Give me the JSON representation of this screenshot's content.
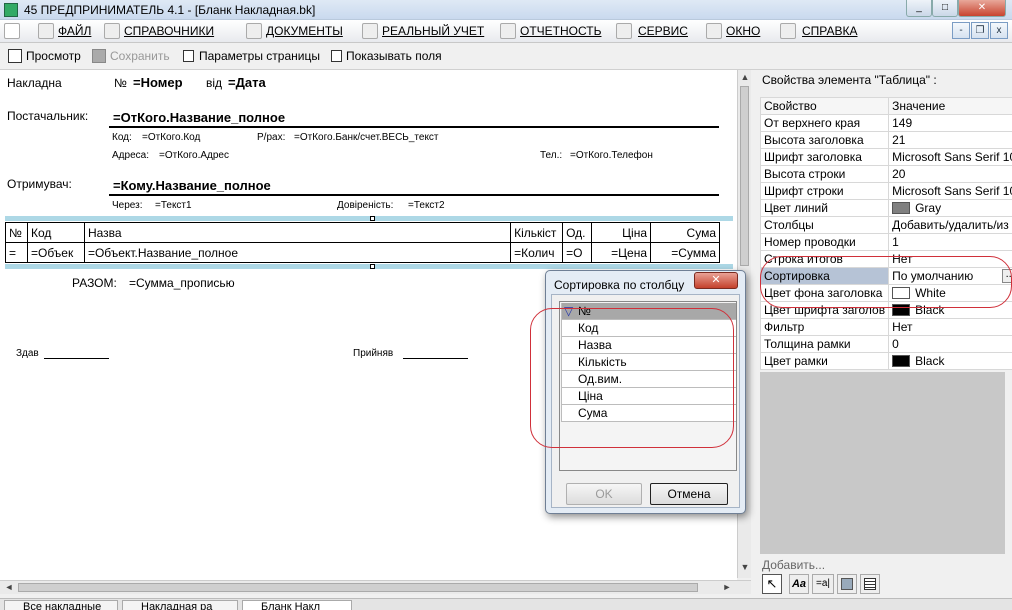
{
  "window": {
    "title": "45  ПРЕДПРИНИМАТЕЛЬ 4.1 - [Бланк  Накладная.bk]",
    "minimize": "_",
    "maximize": "□",
    "close": "✕"
  },
  "menu": {
    "items": [
      "ФАЙЛ",
      "СПРАВОЧНИКИ",
      "ДОКУМЕНТЫ",
      "РЕАЛЬНЫЙ УЧЕТ",
      "ОТЧЕТНОСТЬ",
      "СЕРВИС",
      "ОКНО",
      "СПРАВКА"
    ],
    "mdi_minimize": "-",
    "mdi_restore": "❐",
    "mdi_close": "x"
  },
  "toolbar": {
    "preview": "Просмотр",
    "save": "Сохранить",
    "page_params": "Параметры страницы",
    "show_fields": "Показывать поля"
  },
  "form": {
    "invoice_label": "Накладна",
    "number_label": "№",
    "number_value": "=Номер",
    "from_label": "від",
    "date_value": "=Дата",
    "supplier_label": "Постачальник:",
    "supplier_name": "=ОтКого.Название_полное",
    "code_label": "Код:",
    "code_value": "=ОтКого.Код",
    "account_label": "Р/рах:",
    "account_value": "=ОтКого.Банк/счет.ВЕСЬ_текст",
    "address_label": "Адреса:",
    "address_value": "=ОтКого.Адрес",
    "phone_label": "Тел.:",
    "phone_value": "=ОтКого.Телефон",
    "receiver_label": "Отримувач:",
    "receiver_name": "=Кому.Название_полное",
    "via_label": "Через:",
    "via_value": "=Текст1",
    "trust_label": "Довіреність:",
    "trust_value": "=Текст2",
    "total_label": "РАЗОМ:",
    "total_value": "=Сумма_прописью",
    "gave_label": "Здав",
    "accepted_label": "Прийняв"
  },
  "table": {
    "headers": [
      "№",
      "Код",
      "Назва",
      "Кількіст",
      "Од.",
      "Ціна",
      "Сума"
    ],
    "row": [
      "=",
      "=Объек",
      "=Объект.Название_полное",
      "=Колич",
      "=О",
      "=Цена",
      "=Сумма"
    ]
  },
  "properties": {
    "title": "Свойства элемента \"Таблица\" :",
    "col_property": "Свойство",
    "col_value": "Значение",
    "rows": [
      {
        "name": "От верхнего края",
        "value": "149"
      },
      {
        "name": "Высота заголовка",
        "value": "21"
      },
      {
        "name": "Шрифт заголовка",
        "value": "Microsoft Sans Serif 10"
      },
      {
        "name": "Высота строки",
        "value": "20"
      },
      {
        "name": "Шрифт строки",
        "value": "Microsoft Sans Serif 10"
      },
      {
        "name": "Цвет линий",
        "value": "Gray",
        "color": "#808080"
      },
      {
        "name": "Столбцы",
        "value": "Добавить/удалить/из"
      },
      {
        "name": "Номер проводки",
        "value": "1"
      },
      {
        "name": "Строка итогов",
        "value": "Нет"
      },
      {
        "name": "Сортировка",
        "value": "По умолчанию"
      },
      {
        "name": "Цвет фона заголовка",
        "value": "White",
        "color": "#ffffff"
      },
      {
        "name": "Цвет шрифта заголов",
        "value": "Black",
        "color": "#000000"
      },
      {
        "name": "Фильтр",
        "value": "Нет"
      },
      {
        "name": "Толщина рамки",
        "value": "0"
      },
      {
        "name": "Цвет рамки",
        "value": "Black",
        "color": "#000000"
      }
    ],
    "ellipsis": "...",
    "add_label": "Добавить...",
    "tool_text": "=a|"
  },
  "dialog": {
    "title": "Сортировка по столбцу",
    "close": "✕",
    "items": [
      "№",
      "Код",
      "Назва",
      "Кількість",
      "Од.вим.",
      "Ціна",
      "Сума"
    ],
    "ok": "OK",
    "cancel": "Отмена"
  },
  "taskbar": {
    "items": [
      "Все накладные",
      "Накладная ра",
      "Бланк  Накл"
    ]
  },
  "colors": {
    "selected_row": "#b6c3d6",
    "band": "#add8e6",
    "annotation": "#d0303a"
  }
}
